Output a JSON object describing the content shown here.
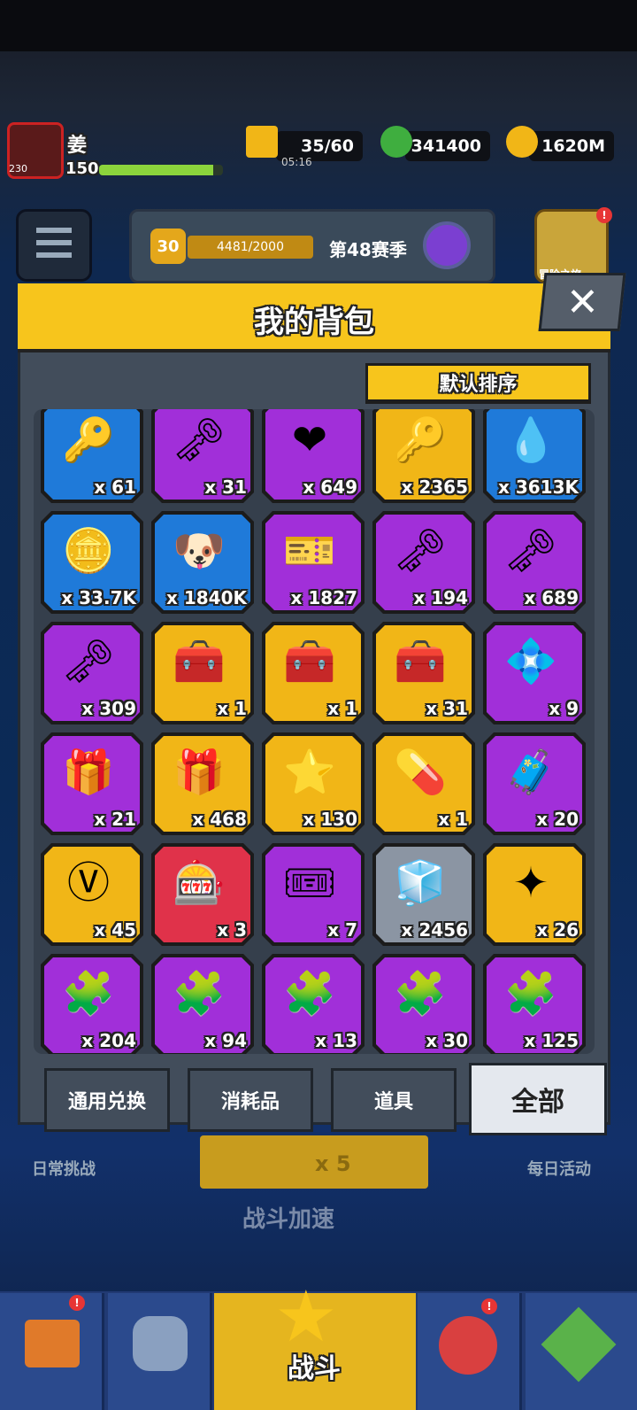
{
  "player": {
    "name": "姜",
    "level": "150",
    "avatar_level": "230"
  },
  "resources": {
    "energy": "35/60",
    "energy_timer": "05:16",
    "gems": "341400",
    "gold": "1620M"
  },
  "season": {
    "level": "30",
    "progress": "4481/2000",
    "label": "第48赛季"
  },
  "event_tile_label": "冒险之旅",
  "panel": {
    "title": "我的背包",
    "close_label": "✕",
    "sort_label": "默认排序"
  },
  "items": [
    {
      "name": "silver-key-icon",
      "count": "x 61",
      "color": "#1f7ad9",
      "icon": "🔑"
    },
    {
      "name": "gold-key-icon",
      "count": "x 31",
      "color": "#a12fd9",
      "icon": "🗝"
    },
    {
      "name": "heart-coin-icon",
      "count": "x 649",
      "color": "#a12fd9",
      "icon": "❤"
    },
    {
      "name": "blue-gem-key-icon",
      "count": "x 2365",
      "color": "#f1b617",
      "icon": "🔑"
    },
    {
      "name": "drop-icon",
      "count": "x 3613K",
      "color": "#1f7ad9",
      "icon": "💧"
    },
    {
      "name": "gold-coin-icon",
      "count": "x 33.7K",
      "color": "#1f7ad9",
      "icon": "🪙"
    },
    {
      "name": "dog-cookie-icon",
      "count": "x 1840K",
      "color": "#1f7ad9",
      "icon": "🐶"
    },
    {
      "name": "ticket-icon",
      "count": "x 1827",
      "color": "#a12fd9",
      "icon": "🎫"
    },
    {
      "name": "orange-key-icon",
      "count": "x 194",
      "color": "#a12fd9",
      "icon": "🗝"
    },
    {
      "name": "purple-gem-key-icon",
      "count": "x 689",
      "color": "#a12fd9",
      "icon": "🗝"
    },
    {
      "name": "hex-key-icon",
      "count": "x 309",
      "color": "#a12fd9",
      "icon": "🗝"
    },
    {
      "name": "chest-icon",
      "count": "x 1",
      "color": "#f1b617",
      "icon": "🧰"
    },
    {
      "name": "chest-star-icon",
      "count": "x 1",
      "color": "#f1b617",
      "icon": "🧰"
    },
    {
      "name": "diamond-chest-icon",
      "count": "x 31",
      "color": "#f1b617",
      "icon": "🧰"
    },
    {
      "name": "card-pack-icon",
      "count": "x 9",
      "color": "#a12fd9",
      "icon": "💠"
    },
    {
      "name": "pink-gift-icon",
      "count": "x 21",
      "color": "#a12fd9",
      "icon": "🎁"
    },
    {
      "name": "gold-gift-icon",
      "count": "x 468",
      "color": "#f1b617",
      "icon": "🎁"
    },
    {
      "name": "star-crystal-icon",
      "count": "x 130",
      "color": "#f1b617",
      "icon": "⭐"
    },
    {
      "name": "capsule-icon",
      "count": "x 1",
      "color": "#f1b617",
      "icon": "💊"
    },
    {
      "name": "purple-chest-icon",
      "count": "x 20",
      "color": "#a12fd9",
      "icon": "🧳"
    },
    {
      "name": "vip-token-icon",
      "count": "x 45",
      "color": "#f1b617",
      "icon": "Ⓥ"
    },
    {
      "name": "vending-machine-icon",
      "count": "x 3",
      "color": "#e0324a",
      "icon": "🎰"
    },
    {
      "name": "star-ticket-icon",
      "count": "x 7",
      "color": "#a12fd9",
      "icon": "🎟"
    },
    {
      "name": "cube-icon",
      "count": "x 2456",
      "color": "#8b95a3",
      "icon": "🧊"
    },
    {
      "name": "gold-star-icon",
      "count": "x 26",
      "color": "#f1b617",
      "icon": "✦"
    },
    {
      "name": "puzzle-red-icon",
      "count": "x 204",
      "color": "#a12fd9",
      "icon": "🧩"
    },
    {
      "name": "puzzle-dark-icon",
      "count": "x 94",
      "color": "#a12fd9",
      "icon": "🧩"
    },
    {
      "name": "puzzle-cat-icon",
      "count": "x 13",
      "color": "#a12fd9",
      "icon": "🧩"
    },
    {
      "name": "puzzle-robot-icon",
      "count": "x 30",
      "color": "#a12fd9",
      "icon": "🧩"
    },
    {
      "name": "puzzle-girl-icon",
      "count": "x 125",
      "color": "#a12fd9",
      "icon": "🧩"
    }
  ],
  "tabs": {
    "exchange": "通用兑换",
    "consumables": "消耗品",
    "props": "道具",
    "all": "全部"
  },
  "under": {
    "daily_challenge": "日常挑战",
    "daily_activity": "每日活动",
    "speed_boost": "战斗加速",
    "energy_multiplier": "x 5"
  },
  "bottom_nav": {
    "battle": "战斗"
  }
}
